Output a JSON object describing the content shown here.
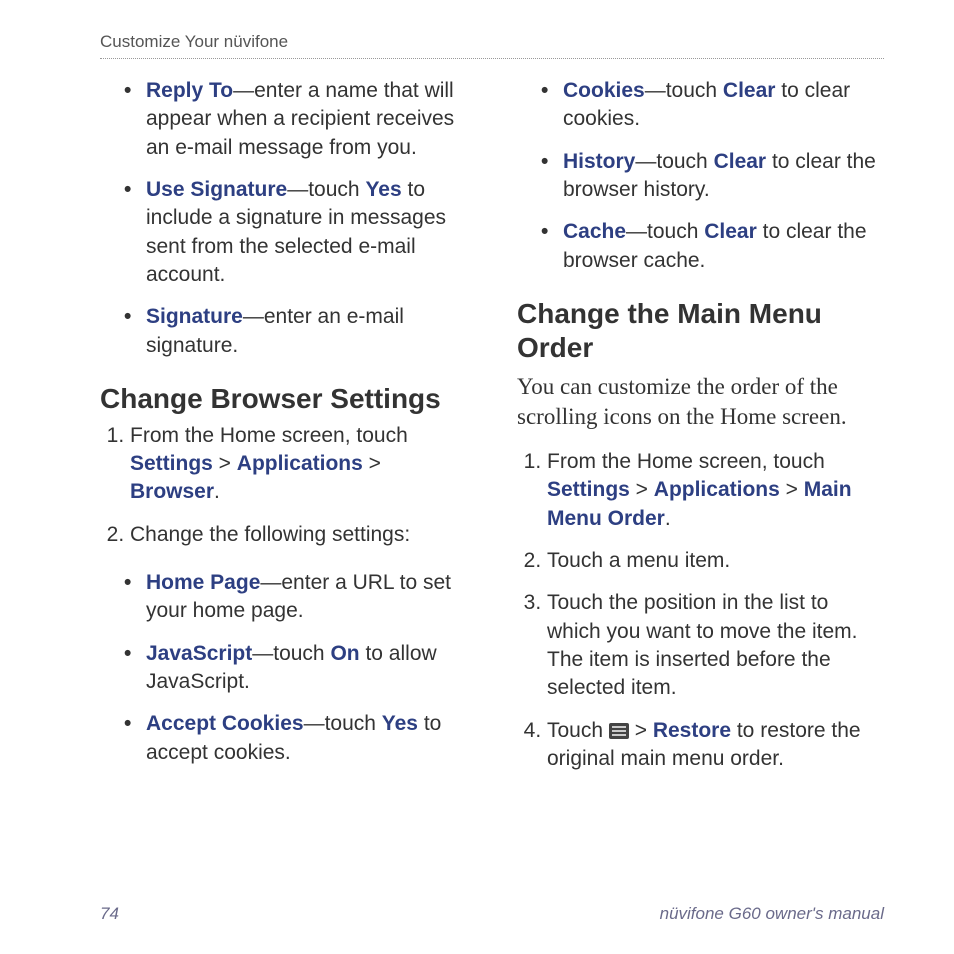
{
  "header": "Customize Your nüvifone",
  "footer": {
    "page": "74",
    "title": "nüvifone G60 owner's manual"
  },
  "left": {
    "topBullets": [
      {
        "term": "Reply To",
        "rest": "—enter a name that will appear when a recipient receives an e-mail message from you."
      },
      {
        "term": "Use Signature",
        "rest_pre": "—touch ",
        "inline": "Yes",
        "rest_post": " to include a signature in messages sent from the selected e-mail account."
      },
      {
        "term": "Signature",
        "rest": "—enter an e-mail signature."
      }
    ],
    "heading": "Change Browser Settings",
    "steps": {
      "s1_pre": "From the Home screen, touch ",
      "s1_a": "Settings",
      "s1_gt1": " > ",
      "s1_b": "Applications",
      "s1_gt2": " > ",
      "s1_c": "Browser",
      "s1_end": ".",
      "s2": "Change the following settings:"
    },
    "subBullets": [
      {
        "term": "Home Page",
        "rest": "—enter a URL to set your home page."
      },
      {
        "term": "JavaScript",
        "rest_pre": "—touch ",
        "inline": "On",
        "rest_post": " to allow JavaScript."
      },
      {
        "term": "Accept Cookies",
        "rest_pre": "—touch ",
        "inline": "Yes",
        "rest_post": " to accept cookies."
      }
    ]
  },
  "right": {
    "topBullets": [
      {
        "term": "Cookies",
        "rest_pre": "—touch ",
        "inline": "Clear",
        "rest_post": " to clear cookies."
      },
      {
        "term": "History",
        "rest_pre": "—touch ",
        "inline": "Clear",
        "rest_post": " to clear the browser history."
      },
      {
        "term": "Cache",
        "rest_pre": "—touch ",
        "inline": "Clear",
        "rest_post": " to clear the browser cache."
      }
    ],
    "heading": "Change the Main Menu Order",
    "intro": "You can customize the order of the scrolling icons on the Home screen.",
    "steps": {
      "s1_pre": "From the Home screen, touch ",
      "s1_a": "Settings",
      "s1_gt1": " > ",
      "s1_b": "Applications",
      "s1_gt2": " > ",
      "s1_c": "Main Menu Order",
      "s1_end": ".",
      "s2": "Touch a menu item.",
      "s3": "Touch the position in the list to which you want to move the item. The item is inserted before the selected item.",
      "s4_pre": "Touch ",
      "s4_gt": " > ",
      "s4_restore": "Restore",
      "s4_post": " to restore the original main menu order."
    }
  }
}
